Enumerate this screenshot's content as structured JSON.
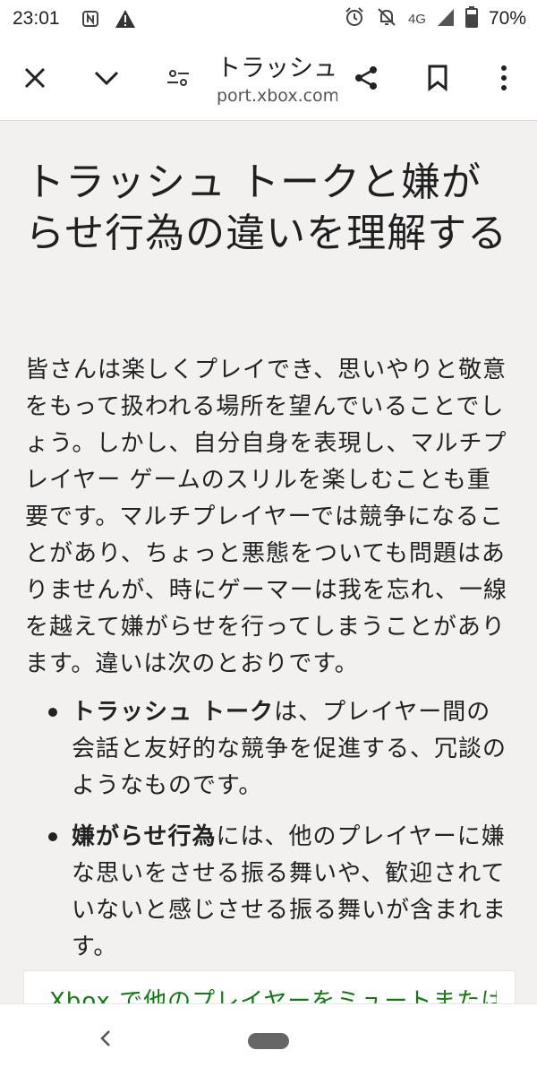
{
  "status_bar": {
    "time": "23:01",
    "network": "4G",
    "battery": "70%",
    "icons": [
      "nfc-icon",
      "warning-icon",
      "alarm-icon",
      "notifications-off-icon",
      "signal-icon",
      "battery-icon"
    ]
  },
  "toolbar": {
    "title": "トラッシュ トーク...",
    "url": "port.xbox.com",
    "icons": [
      "close-icon",
      "chevron-down-icon",
      "page-settings-icon",
      "share-icon",
      "bookmark-icon",
      "more-vert-icon"
    ]
  },
  "article": {
    "heading": "トラッシュ トークと嫌がらせ行為の違いを理解する",
    "paragraph": "皆さんは楽しくプレイでき、思いやりと敬意をもって扱われる場所を望んでいることでしょう。しかし、自分自身を表現し、マルチプレイヤー ゲームのスリルを楽しむことも重要です。マルチプレイヤーでは競争になることがあり、ちょっと悪態をついても問題はありませんが、時にゲーマーは我を忘れ、一線を越えて嫌がらせを行ってしまうことがあります。違いは次のとおりです。",
    "bullets": [
      {
        "term": "トラッシュ トーク",
        "text": "は、プレイヤー間の会話と友好的な競争を促進する、冗談のようなものです。"
      },
      {
        "term": "嫌がらせ行為",
        "text": "には、他のプレイヤーに嫌な思いをさせる振る舞いや、歓迎されていないと感じさせる振る舞いが含まれます。"
      }
    ],
    "card_link": "Xbox で他のプレイヤーをミュートまたは"
  },
  "colors": {
    "background": "#f2f1f0",
    "link": "#107c10",
    "text": "#1f1f1f"
  }
}
